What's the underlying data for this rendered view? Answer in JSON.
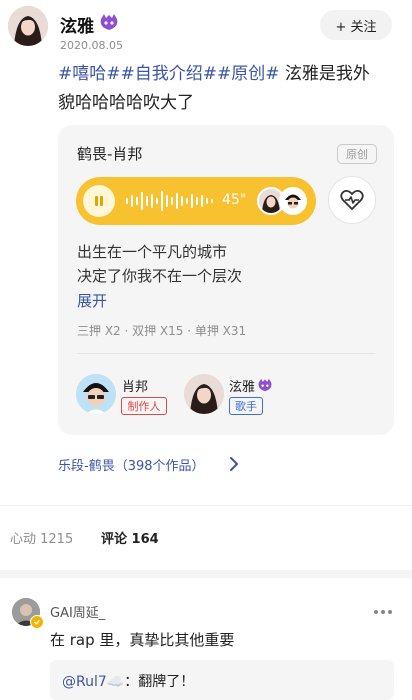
{
  "post": {
    "author": "泫雅",
    "author_badge_icon": "purple-creature-icon",
    "follow_label": "+ 关注",
    "date": "2020.08.05",
    "tags": [
      "#嘻哈#",
      "#自我介绍#",
      "#原创#"
    ],
    "text_line1_tail": "泫雅是我外",
    "text_line2": "貌哈哈哈哈吹大了"
  },
  "card": {
    "title": "鹤畏-肖邦",
    "badge": "原创",
    "duration": "45\"",
    "lyrics": [
      "出生在一个平凡的城市",
      "决定了你我不在一个层次"
    ],
    "expand": "展开",
    "rhymes": "三押 X2 · 双押 X15 · 单押 X31",
    "creators": [
      {
        "name": "肖邦",
        "role": "制作人"
      },
      {
        "name": "泫雅",
        "role": "歌手"
      }
    ],
    "colors": {
      "player": "#f7c12f",
      "role_red": "#e24a4a",
      "role_blue": "#3d6fd8"
    }
  },
  "segment_link": "乐段-鹤畏（398个作品）",
  "stats": {
    "likes_label": "心动 1215",
    "comments_label": "评论 164"
  },
  "comment": {
    "user": "GAI周延_",
    "text": "在 rap 里，真挚比其他重要",
    "reply_user": "@Rul7☁️",
    "reply_text": "：翻牌了！"
  }
}
